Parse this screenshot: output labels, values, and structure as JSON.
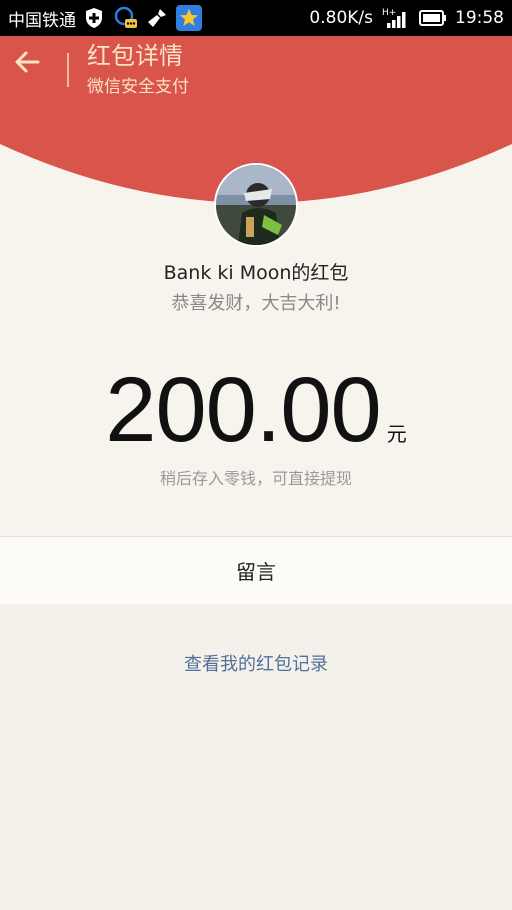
{
  "status_bar": {
    "carrier": "中国铁通",
    "speed": "0.80K/s",
    "network": "H+",
    "time": "19:58",
    "icons": [
      "shield-icon",
      "chat-bot-icon",
      "broom-icon",
      "star-app-icon",
      "signal-icon",
      "battery-icon"
    ]
  },
  "header": {
    "title": "红包详情",
    "subtitle": "微信安全支付",
    "back_icon": "back-arrow-icon",
    "background_color": "#d9544a",
    "text_color": "#fbe3c6"
  },
  "envelope": {
    "sender": "Bank ki Moon的红包",
    "greeting": "恭喜发财，大吉大利!",
    "amount": "200.00",
    "unit": "元",
    "note": "稍后存入零钱，可直接提现"
  },
  "message_label": "留言",
  "records_link": "查看我的红包记录",
  "colors": {
    "accent_red": "#d9544a",
    "link_blue": "#52709c",
    "page_bg": "#f7f4ee"
  }
}
